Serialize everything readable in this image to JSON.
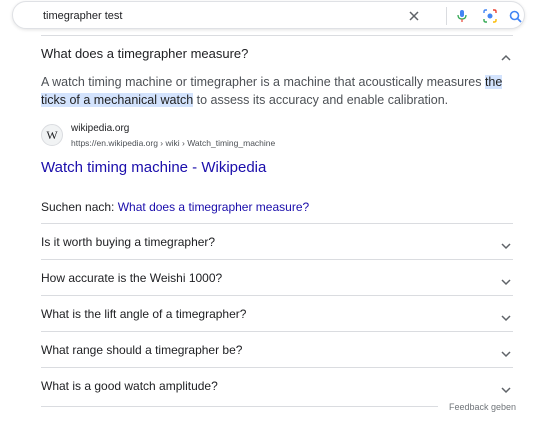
{
  "search": {
    "query": "timegrapher test"
  },
  "expanded": {
    "question": "What does a timegrapher measure?",
    "answer_before": "A watch timing machine or timegrapher is a machine that acoustically measures ",
    "answer_highlight": "the ticks of a mechanical watch",
    "answer_after": " to assess its accuracy and enable calibration.",
    "source_icon_letter": "W",
    "source_site": "wikipedia.org",
    "source_url": "https://en.wikipedia.org › wiki › Watch_timing_machine",
    "result_title": "Watch timing machine - Wikipedia",
    "search_for_label": "Suchen nach: ",
    "search_for_link": "What does a timegrapher measure?"
  },
  "questions": [
    "Is it worth buying a timegrapher?",
    "How accurate is the Weishi 1000?",
    "What is the lift angle of a timegrapher?",
    "What range should a timegrapher be?",
    "What is a good watch amplitude?"
  ],
  "feedback_label": "Feedback geben",
  "colors": {
    "link": "#1a0dab",
    "highlight": "#d3e3fd",
    "divider": "#dadce0"
  }
}
